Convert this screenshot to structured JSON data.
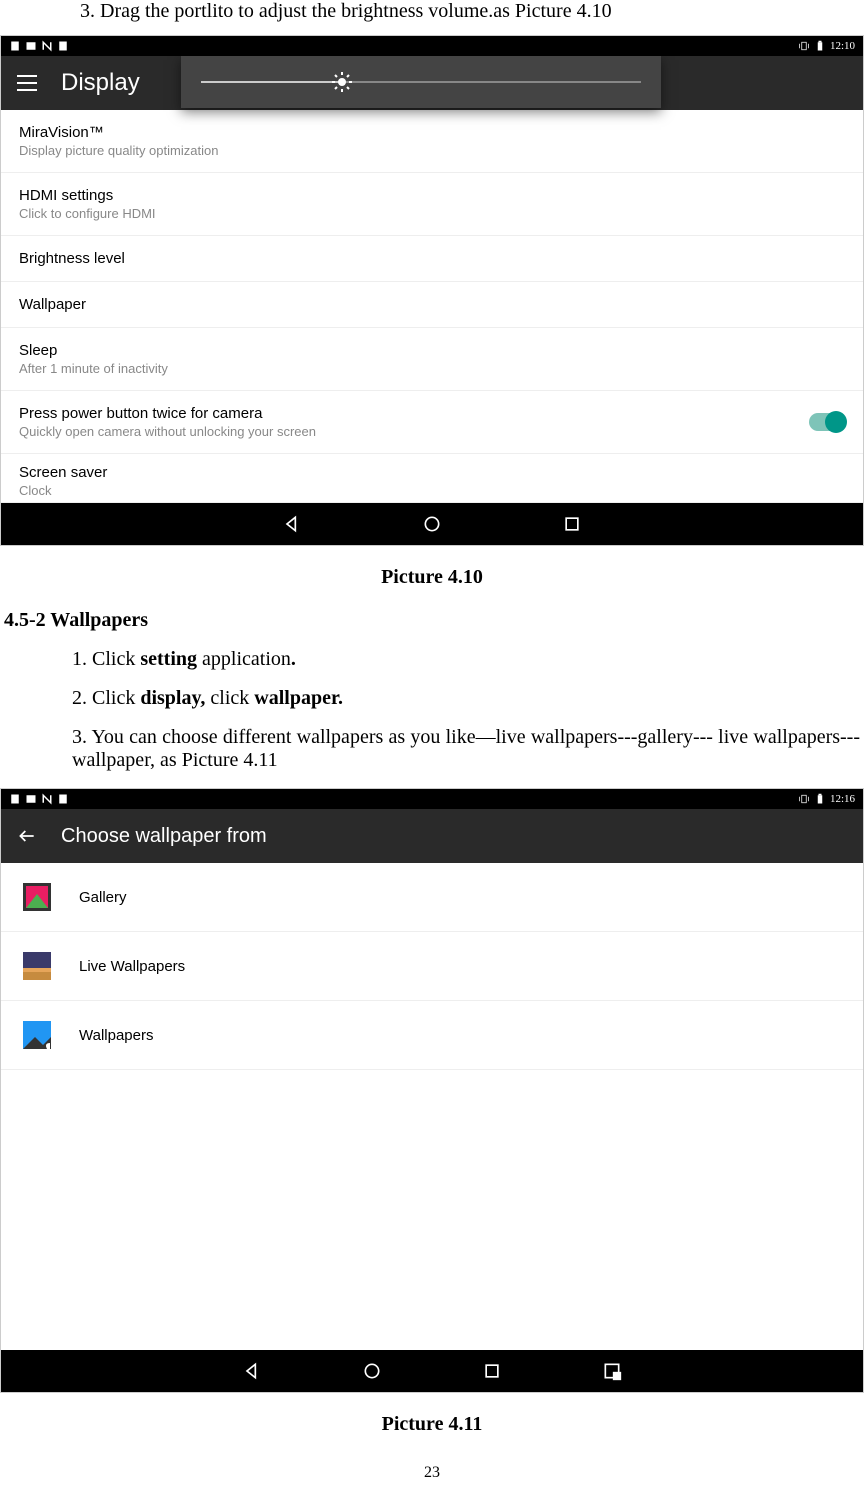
{
  "topStep": "3.    Drag the portlito to adjust the brightness volume.as Picture 4.10",
  "screenshot1": {
    "statusTime": "12:10",
    "appTitle": "Display",
    "items": [
      {
        "title": "MiraVision™",
        "sub": "Display picture quality optimization"
      },
      {
        "title": "HDMI settings",
        "sub": "Click to configure HDMI"
      },
      {
        "title": "Brightness level",
        "sub": ""
      },
      {
        "title": "Wallpaper",
        "sub": ""
      },
      {
        "title": "Sleep",
        "sub": "After 1 minute of inactivity"
      },
      {
        "title": "Press power button twice for camera",
        "sub": "Quickly open camera without unlocking your screen"
      },
      {
        "title": "Screen saver",
        "sub": "Clock"
      }
    ]
  },
  "caption1": "Picture 4.10",
  "sectionHead": "4.5-2 Wallpapers",
  "step1_a": "1. Click ",
  "step1_b": "setting",
  "step1_c": " application",
  "step1_d": ".",
  "step2_a": "2. Click ",
  "step2_b": "display,",
  "step2_c": " click ",
  "step2_d": "wallpaper.",
  "step3": "3. You can choose different wallpapers as you like—live wallpapers---gallery--- live wallpapers---wallpaper, as Picture 4.11",
  "screenshot2": {
    "statusTime": "12:16",
    "appTitle": "Choose wallpaper from",
    "items": [
      {
        "label": "Gallery"
      },
      {
        "label": "Live Wallpapers"
      },
      {
        "label": "Wallpapers"
      }
    ]
  },
  "caption2": "Picture 4.11",
  "pageNum": "23"
}
